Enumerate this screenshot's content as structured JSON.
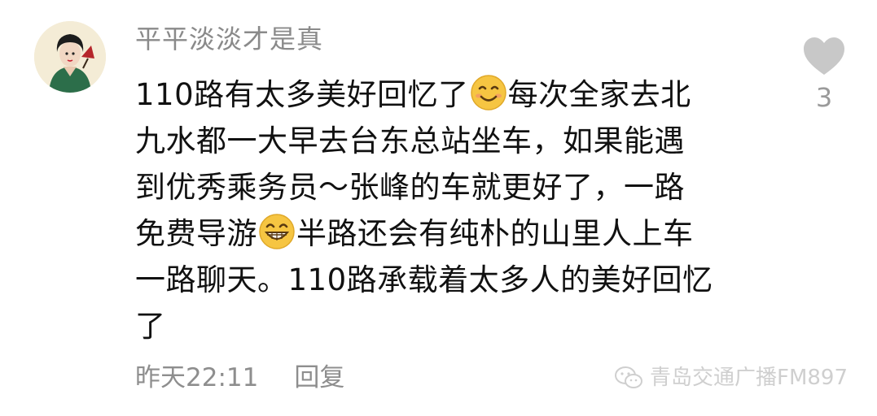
{
  "comment": {
    "username": "平平淡淡才是真",
    "avatar_icon": "portrait-icon",
    "like_icon": "heart-icon",
    "like_count": "3",
    "text_lines": [
      "110路有太多美好回忆了",
      "每次全家去北",
      "九水都一大早去台东总站坐车，如果能遇",
      "到优秀乘务员～张峰的车就更好了，一路",
      "免费导游",
      "半路还会有纯朴的山里人上车",
      "一路聊天。110路承载着太多人的美好回忆",
      "了"
    ],
    "emojis": [
      "smiling-face-icon",
      "grinning-face-icon"
    ],
    "timestamp": "昨天22:11",
    "reply_label": "回复"
  },
  "watermark": {
    "icon": "wechat-icon",
    "text": "青岛交通广播FM897"
  },
  "colors": {
    "username": "#8a8a8a",
    "text": "#111111",
    "meta": "#8e8e8e",
    "heart": "#c8c8c8",
    "emoji": "#f6c542"
  }
}
